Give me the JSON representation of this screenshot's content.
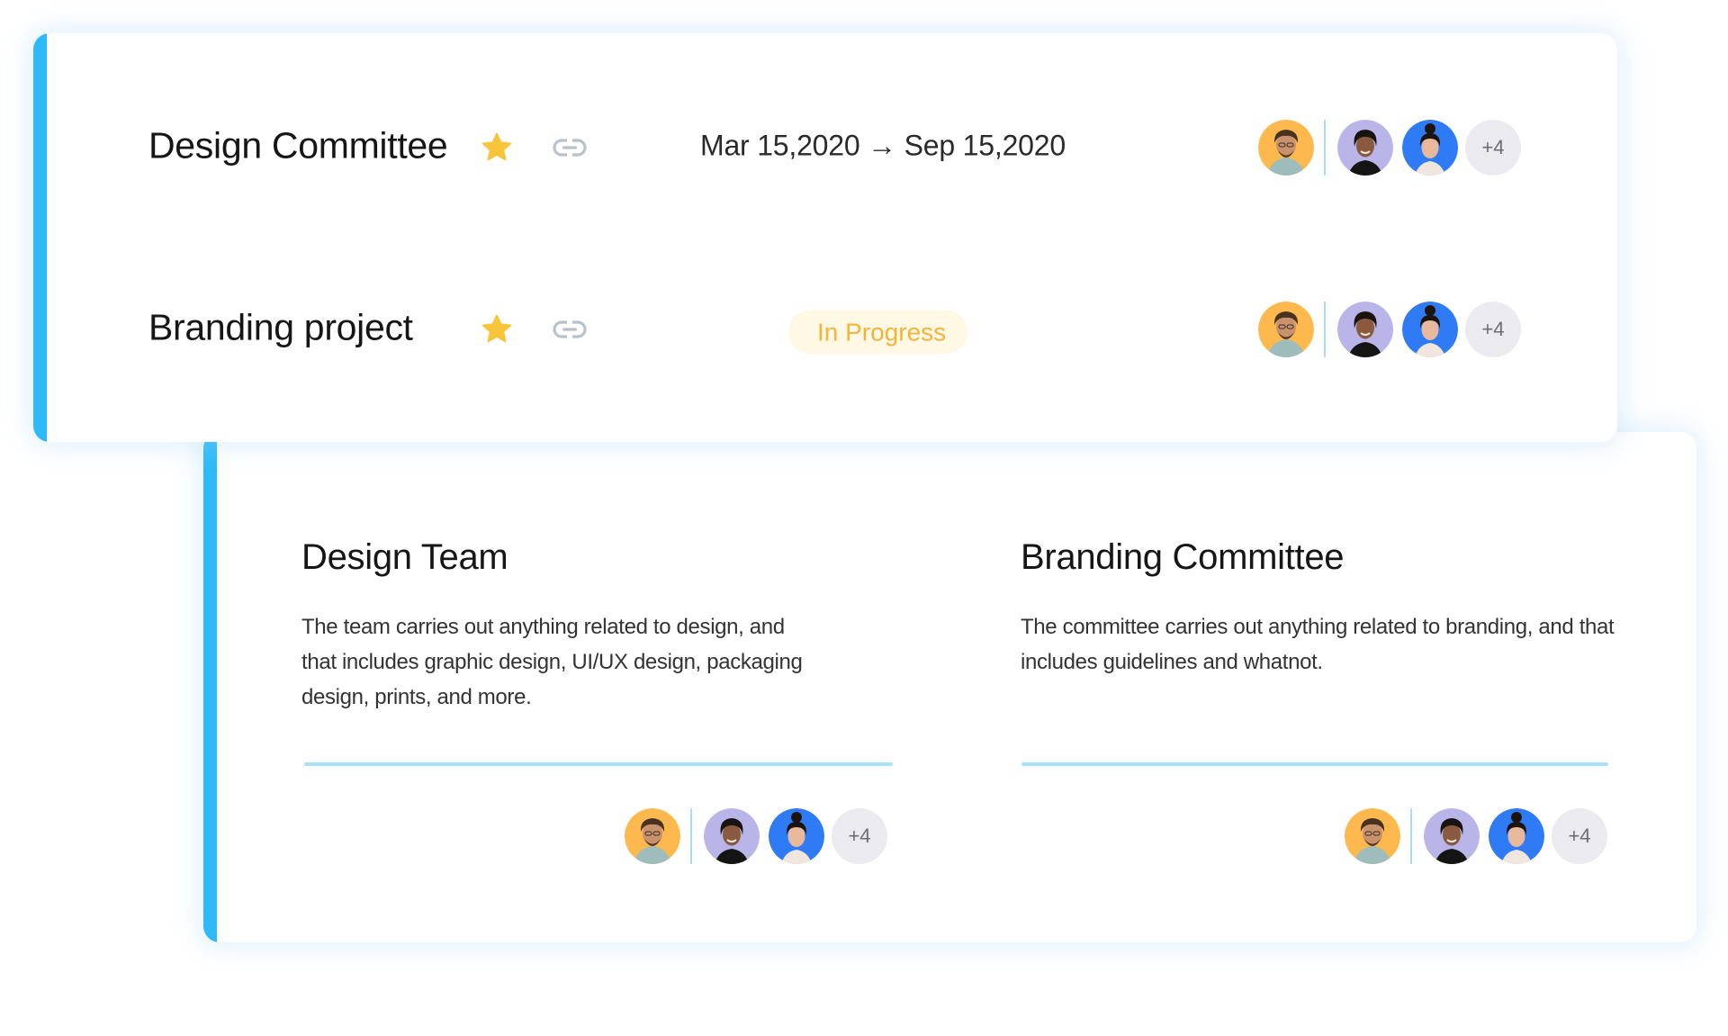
{
  "projects": [
    {
      "title": "Design Committee",
      "starred": true,
      "starred_icon": "star-icon",
      "link_icon": "link-icon",
      "date_range": "Mar 15,2020 → Sep 15,2020",
      "status": null,
      "members": {
        "lead": {
          "name": "avatar-man-curly-hair",
          "bg": "#fdb94e"
        },
        "others": [
          {
            "name": "avatar-woman-dark-hair",
            "bg": "#b9b5e8"
          },
          {
            "name": "avatar-woman-bun",
            "bg": "#2f7bf5"
          }
        ],
        "more_label": "+4"
      }
    },
    {
      "title": "Branding project",
      "starred": true,
      "starred_icon": "star-icon",
      "link_icon": "link-icon",
      "date_range": null,
      "status": "In Progress",
      "members": {
        "lead": {
          "name": "avatar-man-curly-hair",
          "bg": "#fdb94e"
        },
        "others": [
          {
            "name": "avatar-woman-dark-hair",
            "bg": "#b9b5e8"
          },
          {
            "name": "avatar-woman-bun",
            "bg": "#2f7bf5"
          }
        ],
        "more_label": "+4"
      }
    }
  ],
  "teams": [
    {
      "title": "Design Team",
      "description": "The team carries out anything related to design, and that includes graphic design, UI/UX design, packaging design, prints, and more.",
      "members_more_label": "+4"
    },
    {
      "title": "Branding Committee",
      "description": "The committee carries out anything related to branding, and that includes guidelines and whatnot.",
      "members_more_label": "+4"
    }
  ],
  "colors": {
    "accent": "#2ebaf8",
    "star": "#f8c53a",
    "status_text": "#f6b33a",
    "status_bg": "#fff8e5",
    "divider": "#a9e0fb"
  }
}
